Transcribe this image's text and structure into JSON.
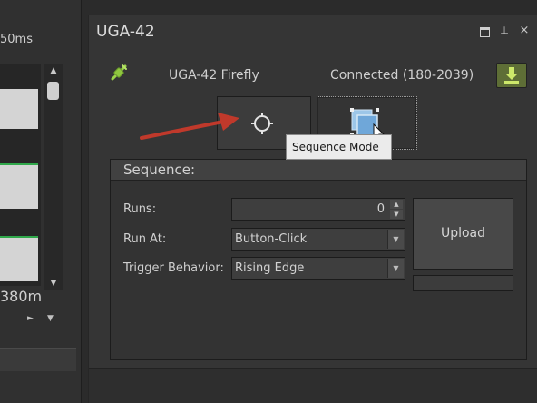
{
  "left_panel": {
    "top_label": "50ms",
    "bottom_label": "380m",
    "scroll_up_glyph": "▲",
    "scroll_down_glyph": "▼",
    "h_scroll_right_glyph": "►",
    "h_scroll_down_glyph": "▼"
  },
  "panel": {
    "title": "UGA-42",
    "pin_glyph": "⊥",
    "close_glyph": "×"
  },
  "device": {
    "name": "UGA-42 Firefly",
    "status": "Connected (180-2039)",
    "icon": "plug-icon",
    "status_color": "#9bd34a"
  },
  "mode_buttons": {
    "crosshair_icon": "crosshair-icon",
    "sequence_icon": "sequence-mode-icon",
    "tooltip": "Sequence Mode"
  },
  "sequence": {
    "title": "Sequence:",
    "runs_label": "Runs:",
    "runs_value": "0",
    "spinner_up": "▲",
    "spinner_down": "▼",
    "run_at_label": "Run At:",
    "run_at_value": "Button-Click",
    "trigger_label": "Trigger Behavior:",
    "trigger_value": "Rising Edge",
    "dropdown_glyph": "▼",
    "upload_label": "Upload",
    "upload_progress": 0
  },
  "annotation": {
    "arrow_color": "#c0392b"
  }
}
